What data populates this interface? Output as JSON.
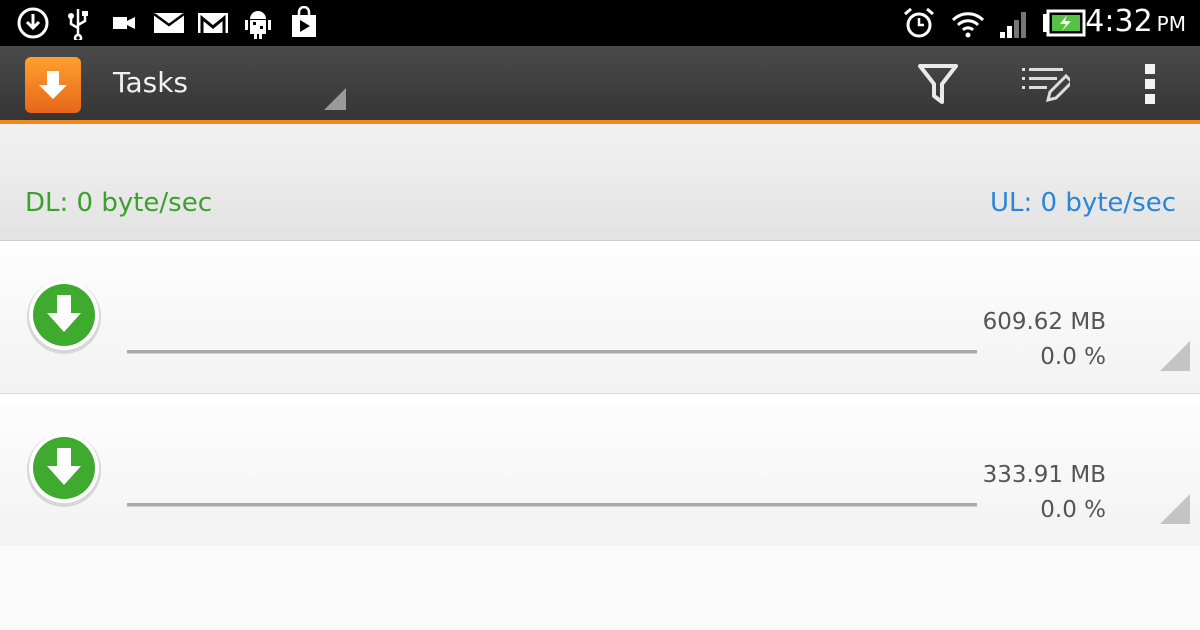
{
  "status_bar": {
    "left_icons": [
      "download-status-icon",
      "usb-icon",
      "video-icon",
      "mail-icon",
      "gmail-icon",
      "android-debug-icon",
      "play-store-icon"
    ],
    "right_icons": [
      "alarm-icon",
      "wifi-icon",
      "signal-icon",
      "battery-charging-icon"
    ],
    "time": "4:32",
    "ampm": "PM"
  },
  "action_bar": {
    "title": "Tasks",
    "app_icon": "app-download-icon",
    "actions": [
      "filter-icon",
      "edit-list-icon",
      "overflow-menu-icon"
    ],
    "accent_color": "#f08a1c"
  },
  "speeds": {
    "download": "DL: 0 byte/sec",
    "upload": "UL: 0 byte/sec",
    "download_color": "#3aa12a",
    "upload_color": "#2a86d6"
  },
  "tasks": [
    {
      "size": "609.62 MB",
      "percent": "0.0 %",
      "progress": 0.0,
      "status_icon": "download-arrow-icon"
    },
    {
      "size": "333.91 MB",
      "percent": "0.0 %",
      "progress": 0.0,
      "status_icon": "download-arrow-icon"
    }
  ]
}
